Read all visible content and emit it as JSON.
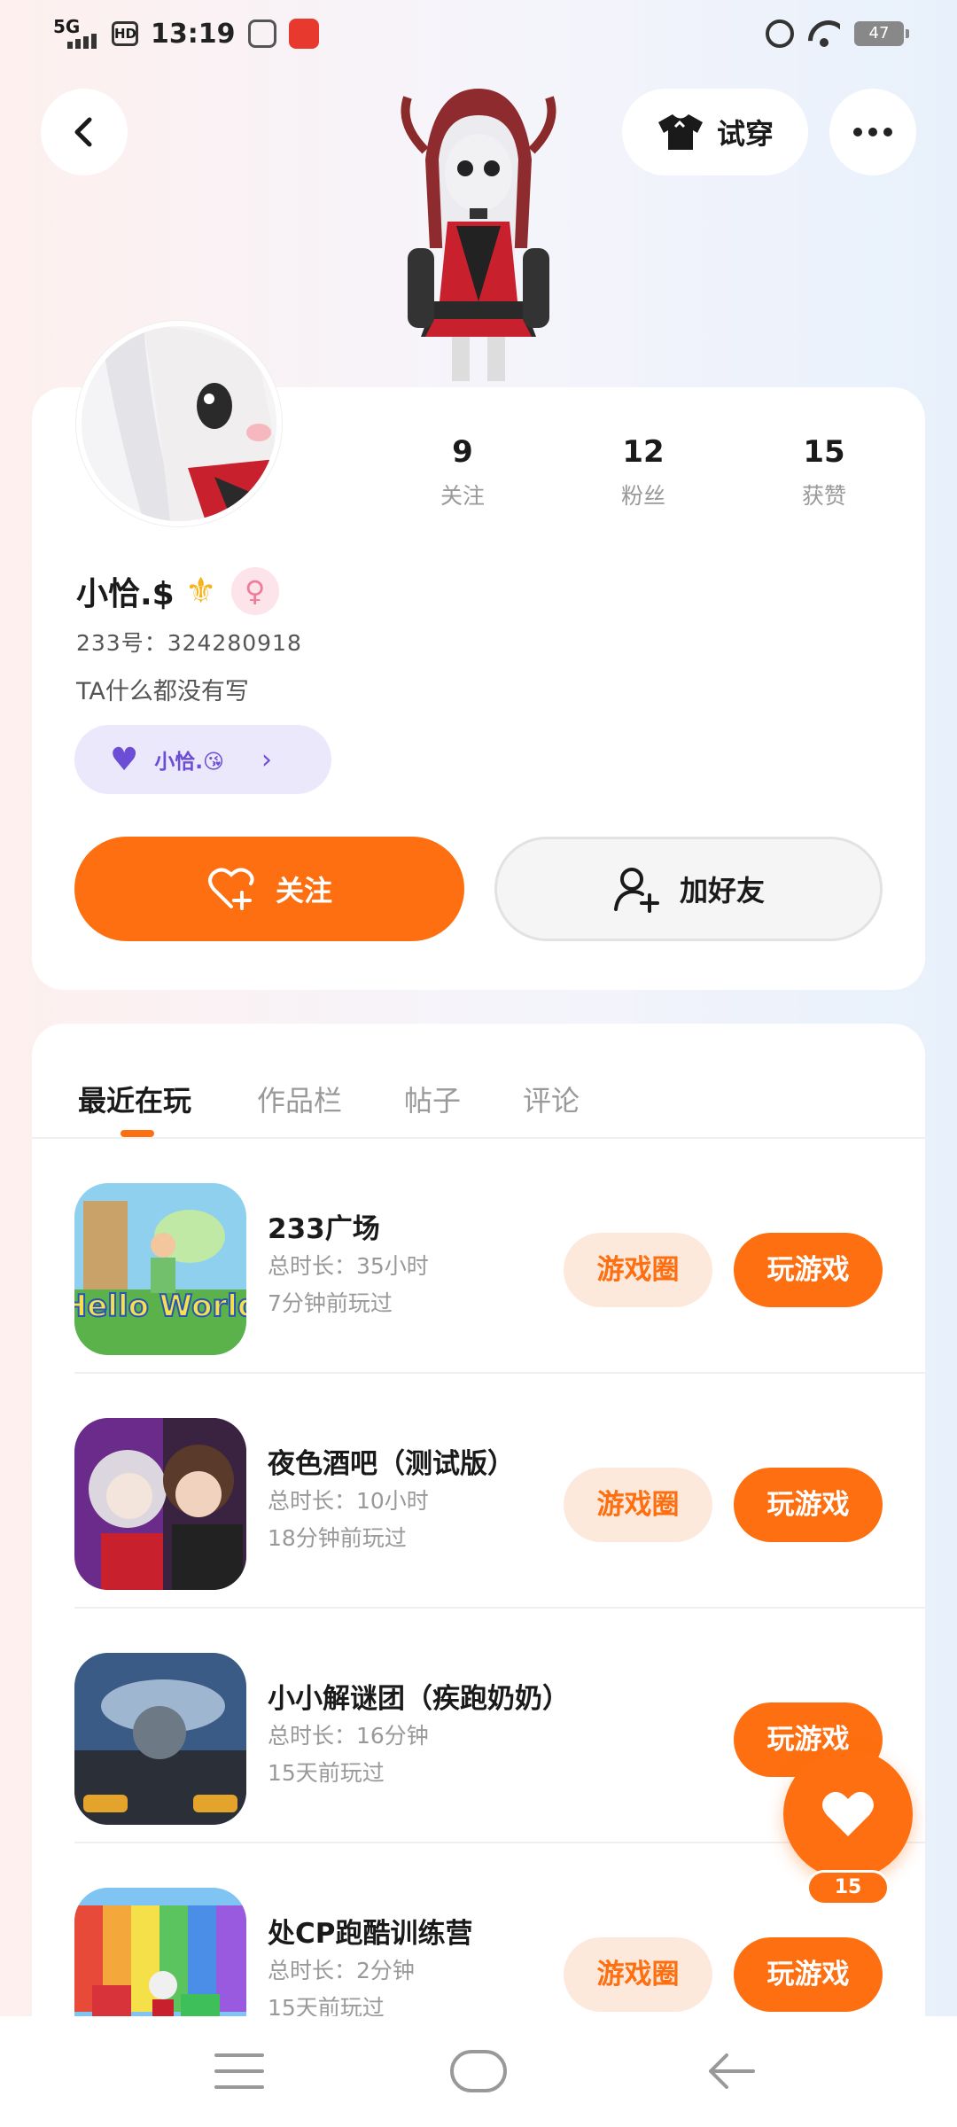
{
  "status_bar": {
    "network": "5G",
    "hd": "HD",
    "time": "13:19",
    "battery": "47"
  },
  "header": {
    "tryon_label": "试穿"
  },
  "profile": {
    "stats": [
      {
        "value": "9",
        "label": "关注"
      },
      {
        "value": "12",
        "label": "粉丝"
      },
      {
        "value": "15",
        "label": "获赞"
      }
    ],
    "nickname": "小恰.$",
    "uid": "233号：324280918",
    "bio": "TA什么都没有写",
    "cp_name": "小恰.😘",
    "follow_label": "关注",
    "add_friend_label": "加好友"
  },
  "tabs": [
    {
      "label": "最近在玩",
      "active": true
    },
    {
      "label": "作品栏",
      "active": false
    },
    {
      "label": "帖子",
      "active": false
    },
    {
      "label": "评论",
      "active": false
    }
  ],
  "games": [
    {
      "title": "233广场",
      "duration": "总时长：35小时",
      "last_played": "7分钟前玩过",
      "circle_label": "游戏圈",
      "play_label": "玩游戏",
      "show_circle": true,
      "thumb_text": "Hello World"
    },
    {
      "title": "夜色酒吧（测试版）",
      "duration": "总时长：10小时",
      "last_played": "18分钟前玩过",
      "circle_label": "游戏圈",
      "play_label": "玩游戏",
      "show_circle": true
    },
    {
      "title": "小小解谜团（疾跑奶奶）",
      "duration": "总时长：16分钟",
      "last_played": "15天前玩过",
      "circle_label": "",
      "play_label": "玩游戏",
      "show_circle": false
    },
    {
      "title": "处CP跑酷训练营",
      "duration": "总时长：2分钟",
      "last_played": "15天前玩过",
      "circle_label": "游戏圈",
      "play_label": "玩游戏",
      "show_circle": true
    }
  ],
  "floating_like": {
    "count": "15"
  },
  "colors": {
    "accent": "#fd6f10",
    "cp_purple": "#6b4dd6"
  }
}
